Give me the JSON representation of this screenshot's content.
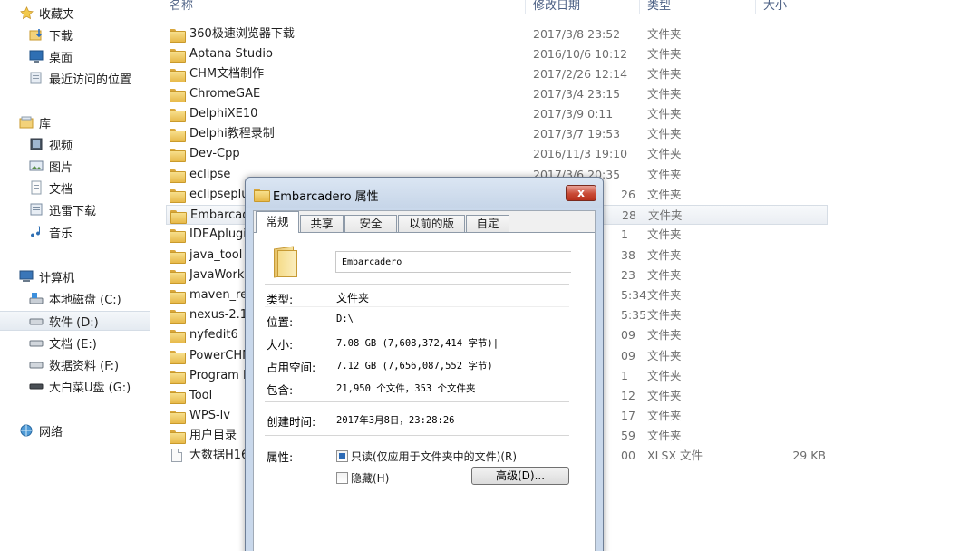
{
  "nav": {
    "favorites": "收藏夹",
    "downloads": "下载",
    "desktop": "桌面",
    "recent": "最近访问的位置",
    "libraries": "库",
    "videos": "视频",
    "pictures": "图片",
    "documents": "文档",
    "thunder": "迅雷下载",
    "music": "音乐",
    "computer": "计算机",
    "drive_c": "本地磁盘 (C:)",
    "drive_d": "软件 (D:)",
    "drive_e": "文档 (E:)",
    "drive_f": "数据资料 (F:)",
    "drive_g": "大白菜U盘 (G:)",
    "network": "网络"
  },
  "columns": {
    "name": "名称",
    "date": "修改日期",
    "type": "类型",
    "size": "大小"
  },
  "files": [
    {
      "name": "360极速浏览器下载",
      "date": "2017/3/8 23:52",
      "type": "文件夹",
      "size": ""
    },
    {
      "name": "Aptana Studio",
      "date": "2016/10/6 10:12",
      "type": "文件夹",
      "size": ""
    },
    {
      "name": "CHM文档制作",
      "date": "2017/2/26 12:14",
      "type": "文件夹",
      "size": ""
    },
    {
      "name": "ChromeGAE",
      "date": "2017/3/4 23:15",
      "type": "文件夹",
      "size": ""
    },
    {
      "name": "DelphiXE10",
      "date": "2017/3/9 0:11",
      "type": "文件夹",
      "size": ""
    },
    {
      "name": "Delphi教程录制",
      "date": "2017/3/7 19:53",
      "type": "文件夹",
      "size": ""
    },
    {
      "name": "Dev-Cpp",
      "date": "2016/11/3 19:10",
      "type": "文件夹",
      "size": ""
    },
    {
      "name": "eclipse",
      "date": "2017/3/6 20:35",
      "type": "文件夹",
      "size": ""
    },
    {
      "name": "eclipseplu",
      "date": "26",
      "type": "文件夹",
      "size": ""
    },
    {
      "name": "Embarcad",
      "date": "28",
      "type": "文件夹",
      "size": ""
    },
    {
      "name": "IDEAplugi",
      "date": "1",
      "type": "文件夹",
      "size": ""
    },
    {
      "name": "java_tool",
      "date": "38",
      "type": "文件夹",
      "size": ""
    },
    {
      "name": "JavaWork",
      "date": "23",
      "type": "文件夹",
      "size": ""
    },
    {
      "name": "maven_rep",
      "date": "5:34",
      "type": "文件夹",
      "size": ""
    },
    {
      "name": "nexus-2.1(",
      "date": "5:35",
      "type": "文件夹",
      "size": ""
    },
    {
      "name": "nyfedit6",
      "date": "09",
      "type": "文件夹",
      "size": ""
    },
    {
      "name": "PowerCHM",
      "date": "09",
      "type": "文件夹",
      "size": ""
    },
    {
      "name": "Program F",
      "date": "1",
      "type": "文件夹",
      "size": ""
    },
    {
      "name": "Tool",
      "date": "12",
      "type": "文件夹",
      "size": ""
    },
    {
      "name": "WPS-lv",
      "date": "17",
      "type": "文件夹",
      "size": ""
    },
    {
      "name": "用户目录",
      "date": "59",
      "type": "文件夹",
      "size": ""
    },
    {
      "name": "大数据H16",
      "date": "00",
      "type": "XLSX 文件",
      "size": "29 KB"
    }
  ],
  "dialog": {
    "title": "Embarcadero 属性",
    "close": "x",
    "tabs": [
      "常规",
      "共享",
      "安全",
      "以前的版本",
      "自定义"
    ],
    "folder_name": "Embarcadero",
    "type_label": "类型:",
    "type_value": "文件夹",
    "location_label": "位置:",
    "location_value": "D:\\",
    "size_label": "大小:",
    "size_value": "7.08 GB (7,608,372,414 字节)|",
    "disk_label": "占用空间:",
    "disk_value": "7.12 GB (7,656,087,552 字节)",
    "contains_label": "包含:",
    "contains_value": "21,950 个文件，353 个文件夹",
    "created_label": "创建时间:",
    "created_value": "2017年3月8日，23:28:26",
    "attr_label": "属性:",
    "readonly": "只读(仅应用于文件夹中的文件)(R)",
    "hidden": "隐藏(H)",
    "advanced": "高级(D)..."
  }
}
